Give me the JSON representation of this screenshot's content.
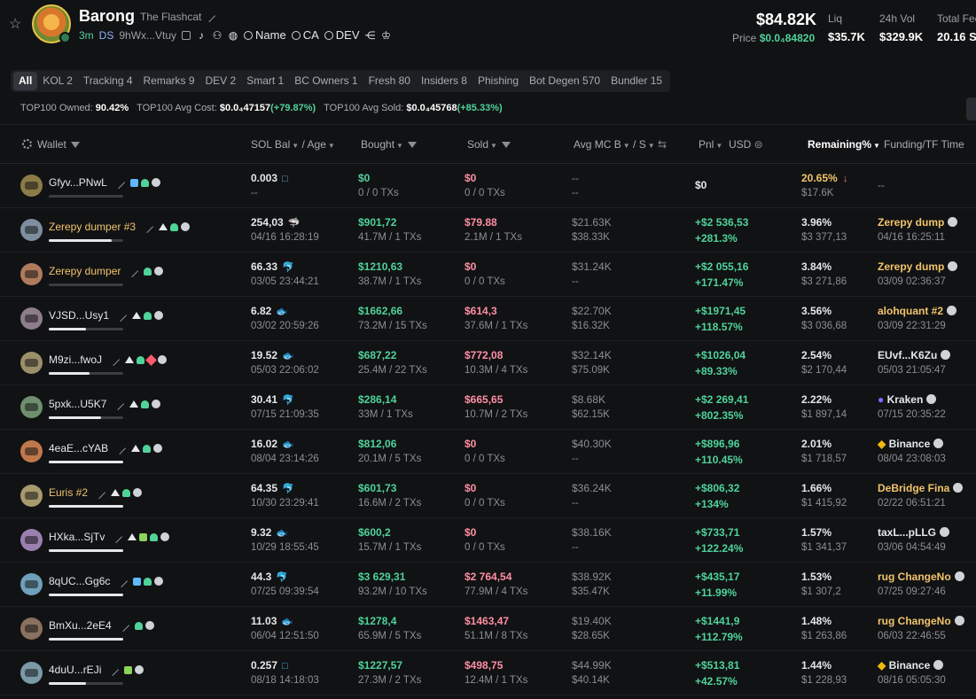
{
  "header": {
    "name": "Barong",
    "subtitle": "The Flashcat",
    "age": "3m",
    "ds": "DS",
    "address": "9hWx...Vtuy",
    "links": [
      "Name",
      "CA",
      "DEV"
    ],
    "price_main": "$84.82K",
    "price_label": "Price",
    "price_value": "$0.0₄84820",
    "stats": [
      {
        "label": "Liq",
        "value": "$35.7K"
      },
      {
        "label": "24h Vol",
        "value": "$329.9K"
      },
      {
        "label": "Total Fee",
        "value": "20.16 S"
      }
    ]
  },
  "tabs": [
    "All",
    "KOL 2",
    "Tracking 4",
    "Remarks 9",
    "DEV 2",
    "Smart 1",
    "BC Owners 1",
    "Fresh 80",
    "Insiders 8",
    "Phishing",
    "Bot Degen 570",
    "Bundler 15"
  ],
  "summary": {
    "owned_label": "TOP100 Owned:",
    "owned_value": "90.42%",
    "cost_label": "TOP100 Avg Cost:",
    "cost_value": "$0.0₄47157",
    "cost_change": "(+79.87%)",
    "sold_label": "TOP100 Avg Sold:",
    "sold_value": "$0.0₄45768",
    "sold_change": "(+85.33%)"
  },
  "columns": {
    "wallet": "Wallet",
    "sol": "SOL Bal",
    "age": "Age",
    "bought": "Bought",
    "sold": "Sold",
    "avgmc": "Avg MC B",
    "avgmc_s": "S",
    "pnl": "Pnl",
    "usd": "USD",
    "remaining": "Remaining%",
    "funding": "Funding/TF Time"
  },
  "rows": [
    {
      "wallet": "Gfyv...PNwL",
      "yellow": false,
      "bar": 0,
      "sol": "0.003",
      "sol_ico": "□",
      "age": "--",
      "bought": "$0",
      "bought_tx": "0 / 0 TXs",
      "sold": "$0",
      "sold_tx": "0 / 0 TXs",
      "mc_b": "--",
      "mc_s": "--",
      "pnl": "$0",
      "pnl_pct": "",
      "rem": "20.65%",
      "rem_usd": "$17.6K",
      "fund": "--",
      "fund_time": "",
      "fund_style": "gy",
      "av": "#8a7b48"
    },
    {
      "wallet": "Zerepy dumper #3",
      "yellow": true,
      "bar": 0.85,
      "sol": "254,03",
      "sol_ico": "🦈",
      "age": "04/16 16:28:19",
      "bought": "$901,72",
      "bought_tx": "41.7M / 1 TXs",
      "sold": "$79.88",
      "sold_tx": "2.1M / 1 TXs",
      "mc_b": "$21.63K",
      "mc_s": "$38.33K",
      "pnl": "+$2 536,53",
      "pnl_pct": "+281.3%",
      "rem": "3.96%",
      "rem_usd": "$3 377,13",
      "fund": "Zerepy dump",
      "fund_time": "04/16 16:25:11",
      "fund_style": "yw",
      "av": "#7d8ea0"
    },
    {
      "wallet": "Zerepy dumper",
      "yellow": true,
      "bar": 0,
      "sol": "66.33",
      "sol_ico": "🐬",
      "age": "03/05 23:44:21",
      "bought": "$1210,63",
      "bought_tx": "38.7M / 1 TXs",
      "sold": "$0",
      "sold_tx": "0 / 0 TXs",
      "mc_b": "$31.24K",
      "mc_s": "--",
      "pnl": "+$2 055,16",
      "pnl_pct": "+171.47%",
      "rem": "3.84%",
      "rem_usd": "$3 271,86",
      "fund": "Zerepy dump",
      "fund_time": "03/09 02:36:37",
      "fund_style": "yw",
      "av": "#b07a5c"
    },
    {
      "wallet": "VJSD...Usy1",
      "yellow": false,
      "bar": 0.5,
      "sol": "6.82",
      "sol_ico": "🐟",
      "age": "03/02 20:59:26",
      "bought": "$1662,66",
      "bought_tx": "73.2M / 15 TXs",
      "sold": "$614,3",
      "sold_tx": "37.6M / 1 TXs",
      "mc_b": "$22.70K",
      "mc_s": "$16.32K",
      "pnl": "+$1971,45",
      "pnl_pct": "+118.57%",
      "rem": "3.56%",
      "rem_usd": "$3 036,68",
      "fund": "alohquant #2",
      "fund_time": "03/09 22:31:29",
      "fund_style": "yw",
      "av": "#8e7d8a"
    },
    {
      "wallet": "M9zi...fwoJ",
      "yellow": false,
      "bar": 0.55,
      "sol": "19.52",
      "sol_ico": "🐟",
      "age": "05/03 22:06:02",
      "bought": "$687,22",
      "bought_tx": "25.4M / 22 TXs",
      "sold": "$772,08",
      "sold_tx": "10.3M / 4 TXs",
      "mc_b": "$32.14K",
      "mc_s": "$75.09K",
      "pnl": "+$1026,04",
      "pnl_pct": "+89.33%",
      "rem": "2.54%",
      "rem_usd": "$2 170,44",
      "fund": "EUvf...K6Zu",
      "fund_time": "05/03 21:05:47",
      "fund_style": "w",
      "av": "#9a8f6a"
    },
    {
      "wallet": "5pxk...U5K7",
      "yellow": false,
      "bar": 0.7,
      "sol": "30.41",
      "sol_ico": "🐬",
      "age": "07/15 21:09:35",
      "bought": "$286,14",
      "bought_tx": "33M / 1 TXs",
      "sold": "$665,65",
      "sold_tx": "10.7M / 2 TXs",
      "mc_b": "$8.68K",
      "mc_s": "$62.15K",
      "pnl": "+$2 269,41",
      "pnl_pct": "+802.35%",
      "rem": "2.22%",
      "rem_usd": "$1 897,14",
      "fund": "Kraken",
      "fund_time": "07/15 20:35:22",
      "fund_style": "w",
      "av": "#6f8f6f"
    },
    {
      "wallet": "4eaE...cYAB",
      "yellow": false,
      "bar": 1,
      "sol": "16.02",
      "sol_ico": "🐟",
      "age": "08/04 23:14:26",
      "bought": "$812,06",
      "bought_tx": "20.1M / 5 TXs",
      "sold": "$0",
      "sold_tx": "0 / 0 TXs",
      "mc_b": "$40.30K",
      "mc_s": "--",
      "pnl": "+$896,96",
      "pnl_pct": "+110.45%",
      "rem": "2.01%",
      "rem_usd": "$1 718,57",
      "fund": "Binance",
      "fund_time": "08/04 23:08:03",
      "fund_style": "w",
      "av": "#c0784a"
    },
    {
      "wallet": "Euris #2",
      "yellow": true,
      "bar": 1,
      "sol": "64.35",
      "sol_ico": "🐬",
      "age": "10/30 23:29:41",
      "bought": "$601,73",
      "bought_tx": "16.6M / 2 TXs",
      "sold": "$0",
      "sold_tx": "0 / 0 TXs",
      "mc_b": "$36.24K",
      "mc_s": "--",
      "pnl": "+$806,32",
      "pnl_pct": "+134%",
      "rem": "1.66%",
      "rem_usd": "$1 415,92",
      "fund": "DeBridge Fina",
      "fund_time": "02/22 06:51:21",
      "fund_style": "yw",
      "av": "#a89a6e"
    },
    {
      "wallet": "HXka...SjTv",
      "yellow": false,
      "bar": 1,
      "sol": "9.32",
      "sol_ico": "🐟",
      "age": "10/29 18:55:45",
      "bought": "$600,2",
      "bought_tx": "15.7M / 1 TXs",
      "sold": "$0",
      "sold_tx": "0 / 0 TXs",
      "mc_b": "$38.16K",
      "mc_s": "--",
      "pnl": "+$733,71",
      "pnl_pct": "+122.24%",
      "rem": "1.57%",
      "rem_usd": "$1 341,37",
      "fund": "taxL...pLLG",
      "fund_time": "03/06 04:54:49",
      "fund_style": "w",
      "av": "#9a7fb0"
    },
    {
      "wallet": "8qUC...Gg6c",
      "yellow": false,
      "bar": 1,
      "sol": "44.3",
      "sol_ico": "🐬",
      "age": "07/25 09:39:54",
      "bought": "$3 629,31",
      "bought_tx": "93.2M / 10 TXs",
      "sold": "$2 764,54",
      "sold_tx": "77.9M / 4 TXs",
      "mc_b": "$38.92K",
      "mc_s": "$35.47K",
      "pnl": "+$435,17",
      "pnl_pct": "+11.99%",
      "rem": "1.53%",
      "rem_usd": "$1 307,2",
      "fund": "rug ChangeNo",
      "fund_time": "07/25 09:27:46",
      "fund_style": "yw",
      "av": "#6fa0b8"
    },
    {
      "wallet": "BmXu...2eE4",
      "yellow": false,
      "bar": 1,
      "sol": "11.03",
      "sol_ico": "🐟",
      "age": "06/04 12:51:50",
      "bought": "$1278,4",
      "bought_tx": "65.9M / 5 TXs",
      "sold": "$1463,47",
      "sold_tx": "51.1M / 8 TXs",
      "mc_b": "$19.40K",
      "mc_s": "$28.65K",
      "pnl": "+$1441,9",
      "pnl_pct": "+112.79%",
      "rem": "1.48%",
      "rem_usd": "$1 263,86",
      "fund": "rug ChangeNo",
      "fund_time": "06/03 22:46:55",
      "fund_style": "yw",
      "av": "#8a7060"
    },
    {
      "wallet": "4duU...rEJi",
      "yellow": false,
      "bar": 0.5,
      "sol": "0.257",
      "sol_ico": "□",
      "age": "08/18 14:18:03",
      "bought": "$1227,57",
      "bought_tx": "27.3M / 2 TXs",
      "sold": "$498,75",
      "sold_tx": "12.4M / 1 TXs",
      "mc_b": "$44.99K",
      "mc_s": "$40.14K",
      "pnl": "+$513,81",
      "pnl_pct": "+42.57%",
      "rem": "1.44%",
      "rem_usd": "$1 228,93",
      "fund": "Binance",
      "fund_time": "08/16 05:05:30",
      "fund_style": "w",
      "av": "#7a9aa8"
    }
  ],
  "colors": {
    "green": "#4fd39a",
    "pink": "#ff8fa3",
    "yellow": "#f1c46b",
    "bg": "#111214"
  }
}
